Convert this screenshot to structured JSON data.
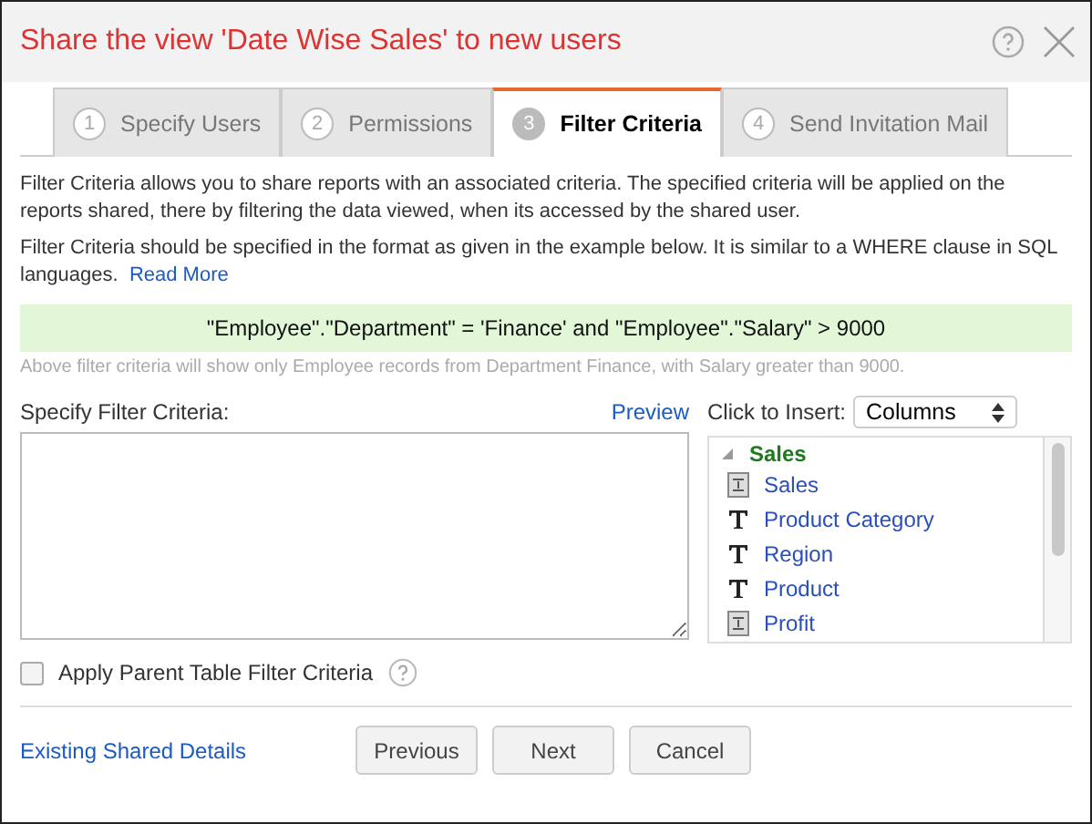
{
  "window": {
    "title": "Share the view 'Date Wise Sales' to new users"
  },
  "tabs": [
    {
      "number": "1",
      "label": "Specify Users",
      "selected": false
    },
    {
      "number": "2",
      "label": "Permissions",
      "selected": false
    },
    {
      "number": "3",
      "label": "Filter Criteria",
      "selected": true
    },
    {
      "number": "4",
      "label": "Send Invitation Mail",
      "selected": false
    }
  ],
  "intro": "Filter Criteria allows you to share reports with an associated criteria. The specified criteria will be applied on the reports shared, there by filtering the data viewed, when its accessed by the shared user.",
  "format_note": "Filter Criteria should be specified in the format as given in the example below. It is similar to a WHERE clause in SQL languages.",
  "read_more": "Read More",
  "example": "\"Employee\".\"Department\" = 'Finance' and \"Employee\".\"Salary\" > 9000",
  "example_note": "Above filter criteria will show only Employee records from Department Finance, with Salary greater than 9000.",
  "criteria": {
    "label": "Specify Filter Criteria:",
    "preview": "Preview"
  },
  "insert": {
    "label": "Click to Insert:",
    "value": "Columns"
  },
  "tree": {
    "name": "Sales",
    "expanded": true,
    "children": [
      {
        "name": "Sales",
        "kind": "number"
      },
      {
        "name": "Product Category",
        "kind": "text"
      },
      {
        "name": "Region",
        "kind": "text"
      },
      {
        "name": "Product",
        "kind": "text"
      },
      {
        "name": "Profit",
        "kind": "number"
      }
    ]
  },
  "apply_parent": {
    "label": "Apply Parent Table Filter Criteria",
    "checked": false
  },
  "existing_link": "Existing Shared Details",
  "buttons": [
    "Previous",
    "Next",
    "Cancel"
  ]
}
